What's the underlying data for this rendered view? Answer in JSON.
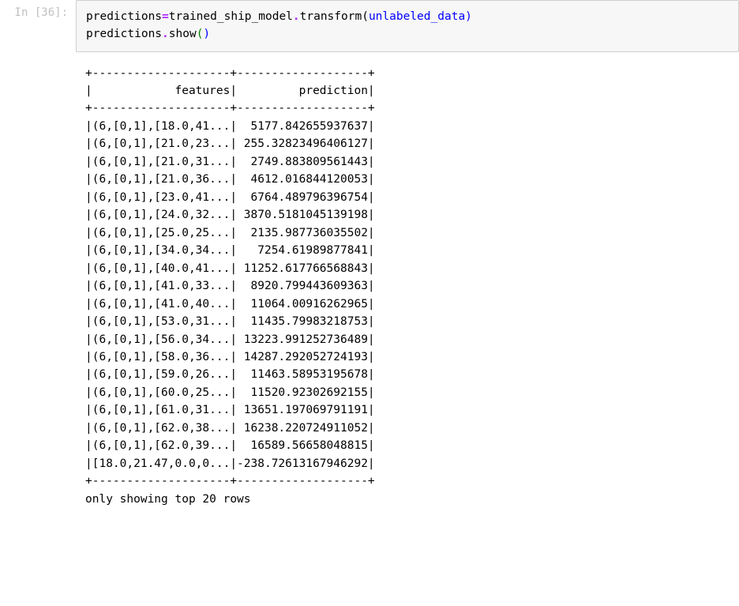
{
  "prompt": {
    "label_in": "In ",
    "open": "[",
    "num": "36",
    "close": "]:"
  },
  "code": {
    "line1": {
      "a": "predictions",
      "eq": "=",
      "b": "trained_ship_model",
      "dot": ".",
      "fn": "transform",
      "po": "(",
      "arg": "unlabeled_data",
      "pc": ")"
    },
    "line2": {
      "a": "predictions",
      "dot": ".",
      "fn": "show",
      "po": "(",
      "pc": ")"
    }
  },
  "table": {
    "border_top": "+--------------------+-------------------+",
    "header": "|            features|         prediction|",
    "border_mid": "+--------------------+-------------------+",
    "rows": [
      "|(6,[0,1],[18.0,41...|  5177.842655937637|",
      "|(6,[0,1],[21.0,23...| 255.32823496406127|",
      "|(6,[0,1],[21.0,31...|  2749.883809561443|",
      "|(6,[0,1],[21.0,36...|  4612.016844120053|",
      "|(6,[0,1],[23.0,41...|  6764.489796396754|",
      "|(6,[0,1],[24.0,32...| 3870.5181045139198|",
      "|(6,[0,1],[25.0,25...|  2135.987736035502|",
      "|(6,[0,1],[34.0,34...|   7254.61989877841|",
      "|(6,[0,1],[40.0,41...| 11252.617766568843|",
      "|(6,[0,1],[41.0,33...|  8920.799443609363|",
      "|(6,[0,1],[41.0,40...|  11064.00916262965|",
      "|(6,[0,1],[53.0,31...|  11435.79983218753|",
      "|(6,[0,1],[56.0,34...| 13223.991252736489|",
      "|(6,[0,1],[58.0,36...| 14287.292052724193|",
      "|(6,[0,1],[59.0,26...|  11463.58953195678|",
      "|(6,[0,1],[60.0,25...|  11520.92302692155|",
      "|(6,[0,1],[61.0,31...| 13651.197069791191|",
      "|(6,[0,1],[62.0,38...| 16238.220724911052|",
      "|(6,[0,1],[62.0,39...|  16589.56658048815|",
      "|[18.0,21.47,0.0,0...|-238.72613167946292|"
    ],
    "border_bot": "+--------------------+-------------------+",
    "footer": "only showing top 20 rows"
  },
  "chart_data": {
    "type": "table",
    "columns": [
      "features",
      "prediction"
    ],
    "rows": [
      {
        "features": "(6,[0,1],[18.0,41...",
        "prediction": 5177.842655937637
      },
      {
        "features": "(6,[0,1],[21.0,23...",
        "prediction": 255.32823496406127
      },
      {
        "features": "(6,[0,1],[21.0,31...",
        "prediction": 2749.883809561443
      },
      {
        "features": "(6,[0,1],[21.0,36...",
        "prediction": 4612.016844120053
      },
      {
        "features": "(6,[0,1],[23.0,41...",
        "prediction": 6764.489796396754
      },
      {
        "features": "(6,[0,1],[24.0,32...",
        "prediction": 3870.5181045139198
      },
      {
        "features": "(6,[0,1],[25.0,25...",
        "prediction": 2135.987736035502
      },
      {
        "features": "(6,[0,1],[34.0,34...",
        "prediction": 7254.61989877841
      },
      {
        "features": "(6,[0,1],[40.0,41...",
        "prediction": 11252.617766568843
      },
      {
        "features": "(6,[0,1],[41.0,33...",
        "prediction": 8920.799443609363
      },
      {
        "features": "(6,[0,1],[41.0,40...",
        "prediction": 11064.00916262965
      },
      {
        "features": "(6,[0,1],[53.0,31...",
        "prediction": 11435.79983218753
      },
      {
        "features": "(6,[0,1],[56.0,34...",
        "prediction": 13223.991252736489
      },
      {
        "features": "(6,[0,1],[58.0,36...",
        "prediction": 14287.292052724193
      },
      {
        "features": "(6,[0,1],[59.0,26...",
        "prediction": 11463.58953195678
      },
      {
        "features": "(6,[0,1],[60.0,25...",
        "prediction": 11520.92302692155
      },
      {
        "features": "(6,[0,1],[61.0,31...",
        "prediction": 13651.197069791191
      },
      {
        "features": "(6,[0,1],[62.0,38...",
        "prediction": 16238.220724911052
      },
      {
        "features": "(6,[0,1],[62.0,39...",
        "prediction": 16589.56658048815
      },
      {
        "features": "[18.0,21.47,0.0,0...",
        "prediction": -238.72613167946292
      }
    ],
    "note": "only showing top 20 rows"
  }
}
